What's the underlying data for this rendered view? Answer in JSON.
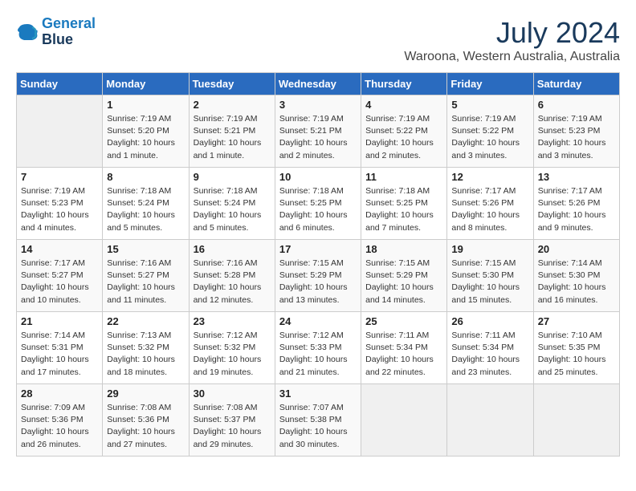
{
  "header": {
    "logo_line1": "General",
    "logo_line2": "Blue",
    "month": "July 2024",
    "location": "Waroona, Western Australia, Australia"
  },
  "weekdays": [
    "Sunday",
    "Monday",
    "Tuesday",
    "Wednesday",
    "Thursday",
    "Friday",
    "Saturday"
  ],
  "weeks": [
    [
      {
        "day": "",
        "info": ""
      },
      {
        "day": "1",
        "info": "Sunrise: 7:19 AM\nSunset: 5:20 PM\nDaylight: 10 hours\nand 1 minute."
      },
      {
        "day": "2",
        "info": "Sunrise: 7:19 AM\nSunset: 5:21 PM\nDaylight: 10 hours\nand 1 minute."
      },
      {
        "day": "3",
        "info": "Sunrise: 7:19 AM\nSunset: 5:21 PM\nDaylight: 10 hours\nand 2 minutes."
      },
      {
        "day": "4",
        "info": "Sunrise: 7:19 AM\nSunset: 5:22 PM\nDaylight: 10 hours\nand 2 minutes."
      },
      {
        "day": "5",
        "info": "Sunrise: 7:19 AM\nSunset: 5:22 PM\nDaylight: 10 hours\nand 3 minutes."
      },
      {
        "day": "6",
        "info": "Sunrise: 7:19 AM\nSunset: 5:23 PM\nDaylight: 10 hours\nand 3 minutes."
      }
    ],
    [
      {
        "day": "7",
        "info": "Sunrise: 7:19 AM\nSunset: 5:23 PM\nDaylight: 10 hours\nand 4 minutes."
      },
      {
        "day": "8",
        "info": "Sunrise: 7:18 AM\nSunset: 5:24 PM\nDaylight: 10 hours\nand 5 minutes."
      },
      {
        "day": "9",
        "info": "Sunrise: 7:18 AM\nSunset: 5:24 PM\nDaylight: 10 hours\nand 5 minutes."
      },
      {
        "day": "10",
        "info": "Sunrise: 7:18 AM\nSunset: 5:25 PM\nDaylight: 10 hours\nand 6 minutes."
      },
      {
        "day": "11",
        "info": "Sunrise: 7:18 AM\nSunset: 5:25 PM\nDaylight: 10 hours\nand 7 minutes."
      },
      {
        "day": "12",
        "info": "Sunrise: 7:17 AM\nSunset: 5:26 PM\nDaylight: 10 hours\nand 8 minutes."
      },
      {
        "day": "13",
        "info": "Sunrise: 7:17 AM\nSunset: 5:26 PM\nDaylight: 10 hours\nand 9 minutes."
      }
    ],
    [
      {
        "day": "14",
        "info": "Sunrise: 7:17 AM\nSunset: 5:27 PM\nDaylight: 10 hours\nand 10 minutes."
      },
      {
        "day": "15",
        "info": "Sunrise: 7:16 AM\nSunset: 5:27 PM\nDaylight: 10 hours\nand 11 minutes."
      },
      {
        "day": "16",
        "info": "Sunrise: 7:16 AM\nSunset: 5:28 PM\nDaylight: 10 hours\nand 12 minutes."
      },
      {
        "day": "17",
        "info": "Sunrise: 7:15 AM\nSunset: 5:29 PM\nDaylight: 10 hours\nand 13 minutes."
      },
      {
        "day": "18",
        "info": "Sunrise: 7:15 AM\nSunset: 5:29 PM\nDaylight: 10 hours\nand 14 minutes."
      },
      {
        "day": "19",
        "info": "Sunrise: 7:15 AM\nSunset: 5:30 PM\nDaylight: 10 hours\nand 15 minutes."
      },
      {
        "day": "20",
        "info": "Sunrise: 7:14 AM\nSunset: 5:30 PM\nDaylight: 10 hours\nand 16 minutes."
      }
    ],
    [
      {
        "day": "21",
        "info": "Sunrise: 7:14 AM\nSunset: 5:31 PM\nDaylight: 10 hours\nand 17 minutes."
      },
      {
        "day": "22",
        "info": "Sunrise: 7:13 AM\nSunset: 5:32 PM\nDaylight: 10 hours\nand 18 minutes."
      },
      {
        "day": "23",
        "info": "Sunrise: 7:12 AM\nSunset: 5:32 PM\nDaylight: 10 hours\nand 19 minutes."
      },
      {
        "day": "24",
        "info": "Sunrise: 7:12 AM\nSunset: 5:33 PM\nDaylight: 10 hours\nand 21 minutes."
      },
      {
        "day": "25",
        "info": "Sunrise: 7:11 AM\nSunset: 5:34 PM\nDaylight: 10 hours\nand 22 minutes."
      },
      {
        "day": "26",
        "info": "Sunrise: 7:11 AM\nSunset: 5:34 PM\nDaylight: 10 hours\nand 23 minutes."
      },
      {
        "day": "27",
        "info": "Sunrise: 7:10 AM\nSunset: 5:35 PM\nDaylight: 10 hours\nand 25 minutes."
      }
    ],
    [
      {
        "day": "28",
        "info": "Sunrise: 7:09 AM\nSunset: 5:36 PM\nDaylight: 10 hours\nand 26 minutes."
      },
      {
        "day": "29",
        "info": "Sunrise: 7:08 AM\nSunset: 5:36 PM\nDaylight: 10 hours\nand 27 minutes."
      },
      {
        "day": "30",
        "info": "Sunrise: 7:08 AM\nSunset: 5:37 PM\nDaylight: 10 hours\nand 29 minutes."
      },
      {
        "day": "31",
        "info": "Sunrise: 7:07 AM\nSunset: 5:38 PM\nDaylight: 10 hours\nand 30 minutes."
      },
      {
        "day": "",
        "info": ""
      },
      {
        "day": "",
        "info": ""
      },
      {
        "day": "",
        "info": ""
      }
    ]
  ]
}
